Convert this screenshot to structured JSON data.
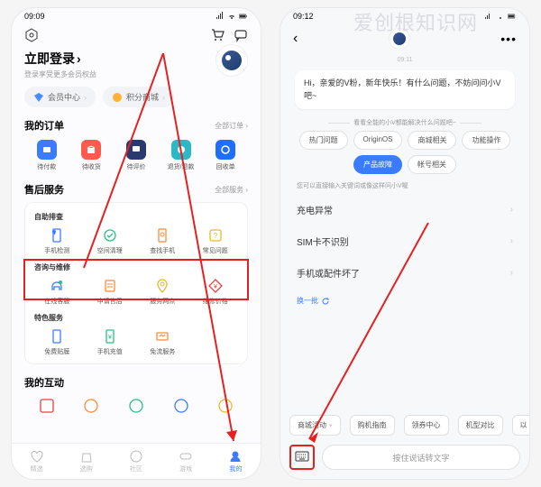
{
  "watermark": "爱创根知识网",
  "left": {
    "status_time": "09:09",
    "login_title": "立即登录",
    "login_sub": "登录享受更多会员权益",
    "pill_member": "会员中心",
    "pill_points": "积分商城",
    "orders": {
      "title": "我的订单",
      "all": "全部订单 ›",
      "items": [
        "待付款",
        "待收货",
        "待评价",
        "退货/退款",
        "回收单"
      ]
    },
    "aftersale": {
      "title": "售后服务",
      "all": "全部服务 ›",
      "self_check": "自助排查",
      "sc_items": [
        "手机检测",
        "空间清理",
        "查找手机",
        "常见问题"
      ],
      "consult": "咨询与维修",
      "cs_items": [
        "在线客服",
        "申请售后",
        "服务网点",
        "维修价格"
      ],
      "feature": "特色服务",
      "ft_items": [
        "免费贴膜",
        "手机充值",
        "免流服务"
      ]
    },
    "interact": "我的互动",
    "tabs": [
      "精选",
      "选购",
      "社区",
      "游戏",
      "我的"
    ]
  },
  "right": {
    "status_time": "09:12",
    "ts": "09:11",
    "greeting": "Hi，亲爱的V粉，新年快乐！有什么问题，不妨问问小V吧~",
    "hint1": "看看全能的小V都能解决什么问题吧~",
    "tags": [
      "热门问题",
      "OriginOS",
      "商城相关",
      "功能操作",
      "产品故障",
      "帐号相关"
    ],
    "hint2": "您可以直接输入关键词或像这样问小V喔",
    "qs": [
      "充电异常",
      "SIM卡不识别",
      "手机或配件坏了"
    ],
    "refresh": "换一批",
    "chips": [
      "商城活动",
      "购机指南",
      "领券中心",
      "机型对比",
      "以"
    ],
    "voice": "按住说话转文字"
  }
}
